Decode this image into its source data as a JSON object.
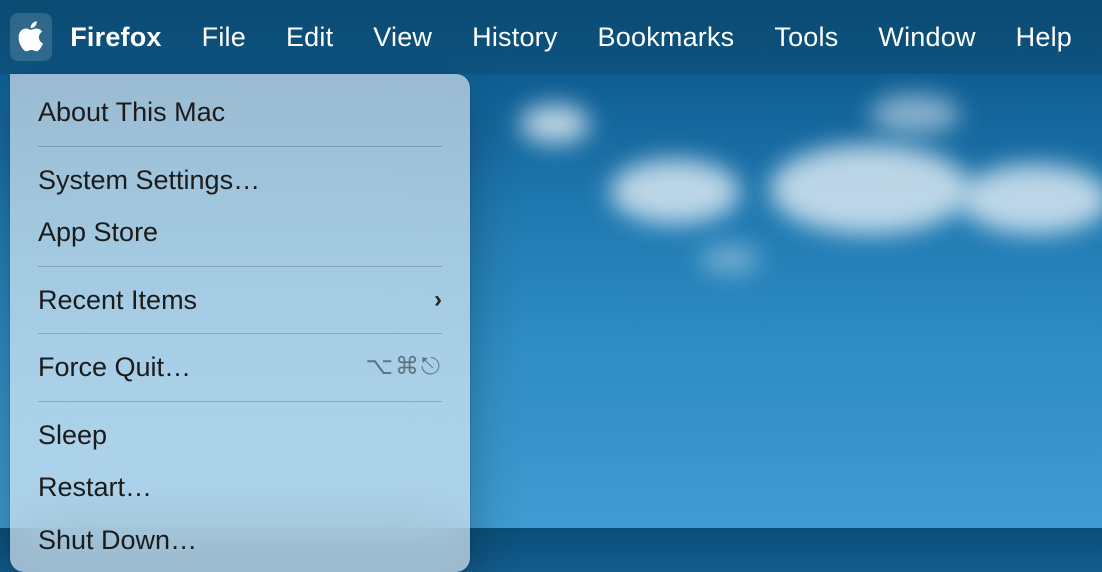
{
  "menubar": {
    "app_name": "Firefox",
    "items": [
      "File",
      "Edit",
      "View",
      "History",
      "Bookmarks",
      "Tools",
      "Window",
      "Help"
    ]
  },
  "apple_menu": {
    "about": "About This Mac",
    "system_settings": "System Settings…",
    "app_store": "App Store",
    "recent_items": "Recent Items",
    "force_quit": "Force Quit…",
    "force_quit_shortcut": "⌥⌘⎋",
    "sleep": "Sleep",
    "restart": "Restart…",
    "shut_down": "Shut Down…"
  }
}
